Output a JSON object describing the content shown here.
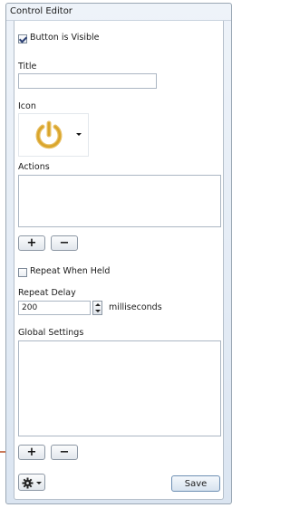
{
  "window": {
    "title": "Control Editor"
  },
  "visibility": {
    "label": "Button is Visible",
    "checked": true
  },
  "title_field": {
    "label": "Title",
    "value": ""
  },
  "icon_field": {
    "label": "Icon",
    "icon": "power-icon",
    "color": "#d9a52b"
  },
  "actions": {
    "label": "Actions",
    "add_symbol": "+",
    "remove_symbol": "−"
  },
  "repeat": {
    "label": "Repeat When Held",
    "checked": false
  },
  "repeat_delay": {
    "label": "Repeat Delay",
    "value": "200",
    "unit": "milliseconds"
  },
  "global_settings": {
    "label": "Global Settings",
    "add_symbol": "+",
    "remove_symbol": "−"
  },
  "footer": {
    "save_label": "Save",
    "settings_icon": "gear-icon"
  },
  "annotation": {
    "arrow": "pointer-arrow",
    "color": "#b84a1f"
  }
}
